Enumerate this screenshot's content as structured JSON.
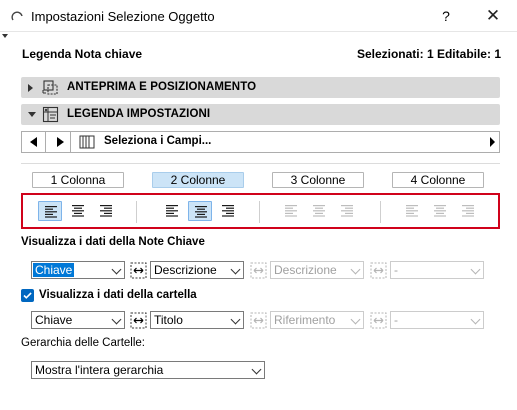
{
  "window": {
    "title": "Impostazioni Selezione Oggetto",
    "help_label": "?",
    "close_label": "✕"
  },
  "panel": {
    "title": "Legenda Nota chiave",
    "selection_info": "Selezionati: 1 Editabile: 1"
  },
  "sections": {
    "preview": "ANTEPRIMA E POSIZIONAMENTO",
    "legend": "LEGENDA IMPOSTAZIONI"
  },
  "navigator": {
    "field_label": "Seleziona i Campi..."
  },
  "column_tabs": [
    {
      "label": "1 Colonna",
      "active": false
    },
    {
      "label": "2 Colonne",
      "active": true
    },
    {
      "label": "3 Colonne",
      "active": false
    },
    {
      "label": "4 Colonne",
      "active": false
    }
  ],
  "alignment": {
    "groups": [
      {
        "enabled": true,
        "selected": "left"
      },
      {
        "enabled": true,
        "selected": "center"
      },
      {
        "enabled": false,
        "selected": "left"
      },
      {
        "enabled": false,
        "selected": "left"
      }
    ]
  },
  "note_data": {
    "label": "Visualizza i dati della Note Chiave",
    "field1": "Chiave",
    "field2": "Descrizione",
    "field3": "Descrizione",
    "field4": "-"
  },
  "folder_data": {
    "label": "Visualizza i dati della cartella",
    "checked": true,
    "field1": "Chiave",
    "field2": "Titolo",
    "field3": "Riferimento",
    "field4": "-"
  },
  "hierarchy": {
    "label": "Gerarchia delle Cartelle:",
    "value": "Mostra l'intera gerarchia"
  },
  "colors": {
    "accent": "#0078d7",
    "selected_bg": "#cce4f7",
    "section_bg": "#d9d9d9",
    "highlight_border": "#d0021b"
  }
}
